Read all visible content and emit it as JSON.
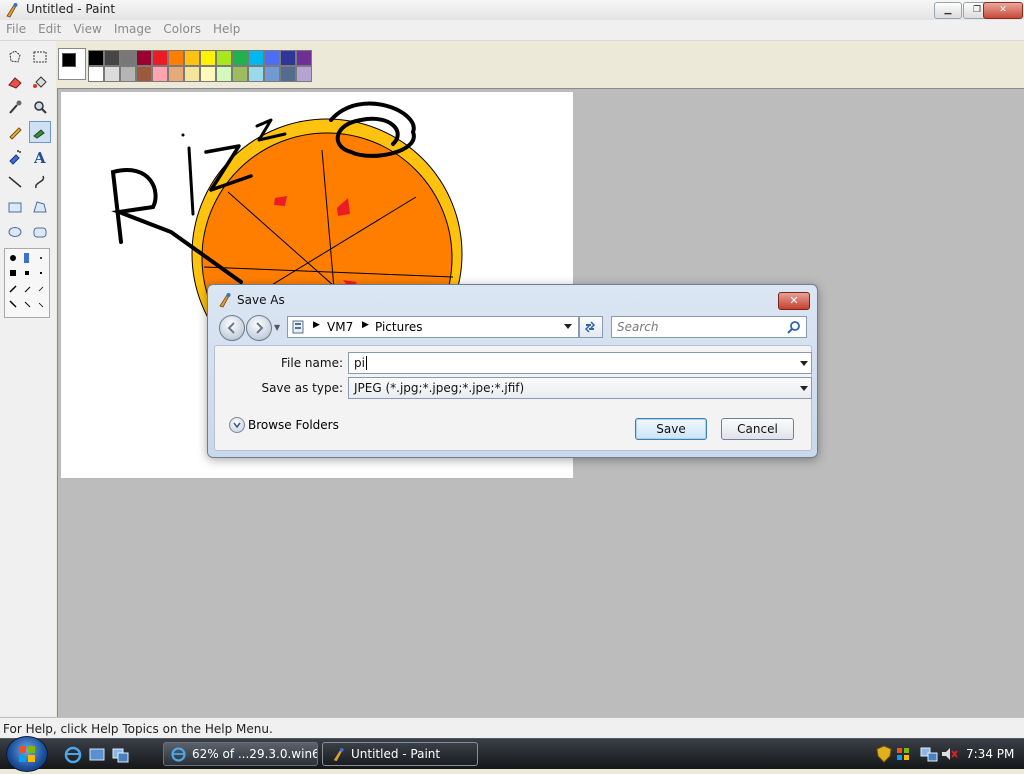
{
  "window": {
    "title": "Untitled - Paint",
    "controls": {
      "minimize": "▁",
      "maximize": "❐",
      "close": "✕"
    }
  },
  "menu": [
    "File",
    "Edit",
    "View",
    "Image",
    "Colors",
    "Help"
  ],
  "palette": {
    "foreground": "#000000",
    "background": "#ffffff",
    "row1": [
      "#000000",
      "#464646",
      "#787878",
      "#990030",
      "#ed1c24",
      "#ff7e00",
      "#ffc20e",
      "#fff200",
      "#a8e61d",
      "#22b14c",
      "#00b7ef",
      "#4d6df3",
      "#2f3699",
      "#6f3198"
    ],
    "row2": [
      "#ffffff",
      "#dcdcdc",
      "#b4b4b4",
      "#9c5a3c",
      "#ffa3b1",
      "#e5aa7a",
      "#f5e49c",
      "#fff9bd",
      "#d3f9bc",
      "#9dbb61",
      "#99d9ea",
      "#709ad1",
      "#546d8e",
      "#b5a5d5"
    ]
  },
  "tools": [
    "free-select-icon",
    "rect-select-icon",
    "eraser-icon",
    "fill-icon",
    "picker-icon",
    "magnifier-icon",
    "pencil-icon",
    "brush-icon",
    "airbrush-icon",
    "text-icon",
    "line-icon",
    "curve-icon",
    "rectangle-icon",
    "polygon-icon",
    "ellipse-icon",
    "rounded-rect-icon"
  ],
  "status": "For Help, click Help Topics on the Help Menu.",
  "dialog": {
    "title": "Save As",
    "breadcrumb": [
      "VM7",
      "Pictures"
    ],
    "search_placeholder": "Search",
    "file_name_label": "File name:",
    "file_name_value": "pi",
    "save_type_label": "Save as type:",
    "save_type_value": "JPEG (*.jpg;*.jpeg;*.jpe;*.jfif)",
    "browse_folders": "Browse Folders",
    "save": "Save",
    "cancel": "Cancel"
  },
  "taskbar": {
    "tasks": [
      {
        "label": "62% of ...29.3.0.win6...",
        "icon": "ie-icon"
      },
      {
        "label": "Untitled - Paint",
        "icon": "paint-icon"
      }
    ],
    "clock": "7:34 PM"
  },
  "drawing": {
    "text": "RIZZ",
    "orange_fill": "#ff7e00",
    "rim_color": "#ffc20e",
    "pepperoni_color": "#ed1c24"
  }
}
